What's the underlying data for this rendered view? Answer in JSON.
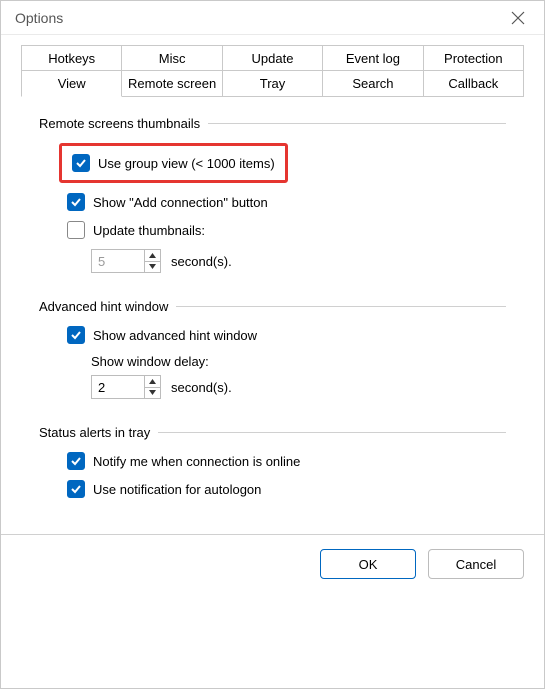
{
  "window": {
    "title": "Options"
  },
  "tabs": {
    "row1": [
      "Hotkeys",
      "Misc",
      "Update",
      "Event log",
      "Protection"
    ],
    "row2": [
      "View",
      "Remote screen",
      "Tray",
      "Search",
      "Callback"
    ],
    "active": "View"
  },
  "groups": {
    "thumbnails": {
      "title": "Remote screens thumbnails",
      "use_group_view": {
        "label": "Use group view (< 1000 items)",
        "checked": true
      },
      "show_add_connection": {
        "label": "Show \"Add connection\" button",
        "checked": true
      },
      "update_thumbs": {
        "label": "Update thumbnails:",
        "checked": false
      },
      "interval": {
        "value": "5",
        "unit": "second(s)."
      }
    },
    "hint": {
      "title": "Advanced hint window",
      "show_hint": {
        "label": "Show advanced hint window",
        "checked": true
      },
      "delay_label": "Show window delay:",
      "delay": {
        "value": "2",
        "unit": "second(s)."
      }
    },
    "alerts": {
      "title": "Status alerts in tray",
      "notify_online": {
        "label": "Notify me when connection is online",
        "checked": true
      },
      "notify_autologon": {
        "label": "Use notification for autologon",
        "checked": true
      }
    }
  },
  "buttons": {
    "ok": "OK",
    "cancel": "Cancel"
  }
}
